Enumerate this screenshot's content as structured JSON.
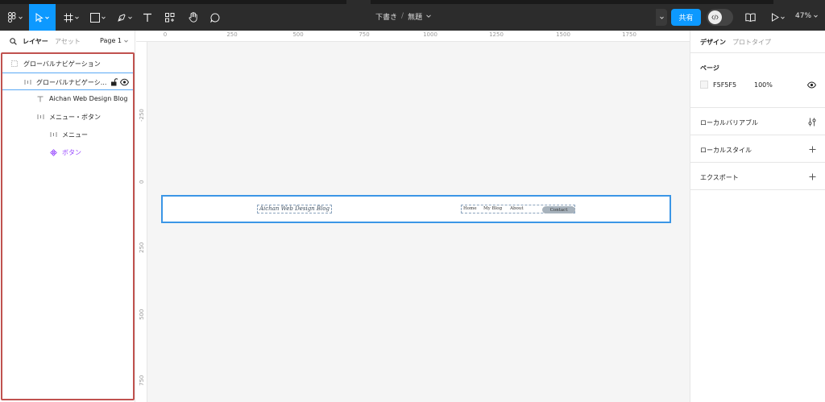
{
  "colors": {
    "toolbar_bg": "#2c2c2c",
    "accent": "#0d99ff",
    "layers_highlight": "#c0524f",
    "selection": "#3b96e6",
    "component_purple": "#9747ff",
    "canvas_bg": "#f5f5f5"
  },
  "toolbar": {
    "icons": [
      "figma-menu-icon",
      "move-tool-icon",
      "frame-tool-icon",
      "shape-tool-icon",
      "pen-tool-icon",
      "text-tool-icon",
      "resources-icon",
      "hand-tool-icon",
      "comment-icon"
    ],
    "breadcrumb": {
      "project": "下書き",
      "separator": "/",
      "file": "無題"
    },
    "share_label": "共有",
    "zoom": "47%"
  },
  "left_panel": {
    "tabs": {
      "layers": "レイヤー",
      "assets": "アセット"
    },
    "page_selector": "Page 1",
    "layers": [
      {
        "label": "グローバルナビゲーション",
        "icon": "frame-icon"
      },
      {
        "label": "グローバルナビゲーシ...",
        "icon": "autolayout-icon"
      },
      {
        "label": "Aichan Web Design Blog",
        "icon": "text-layer-icon"
      },
      {
        "label": "メニュー・ボタン",
        "icon": "autolayout-icon"
      },
      {
        "label": "メニュー",
        "icon": "autolayout-icon"
      },
      {
        "label": "ボタン",
        "icon": "component-icon"
      }
    ]
  },
  "canvas": {
    "ruler_top": [
      "0",
      "250",
      "500",
      "750",
      "1000",
      "1250",
      "1500",
      "1750"
    ],
    "ruler_left": [
      "-250",
      "0",
      "250",
      "500",
      "750"
    ],
    "frame": {
      "logo": "Aichan Web Design Blog",
      "menu": [
        "Home",
        "My Blog",
        "About"
      ],
      "button": "Contact"
    }
  },
  "right_panel": {
    "tabs": {
      "design": "デザイン",
      "prototype": "プロトタイプ"
    },
    "page": {
      "title": "ページ",
      "color": "F5F5F5",
      "opacity": "100%"
    },
    "sections": [
      {
        "title": "ローカルバリアブル",
        "icon": "sliders-icon"
      },
      {
        "title": "ローカルスタイル",
        "icon": "plus-icon"
      },
      {
        "title": "エクスポート",
        "icon": "plus-icon"
      }
    ]
  }
}
